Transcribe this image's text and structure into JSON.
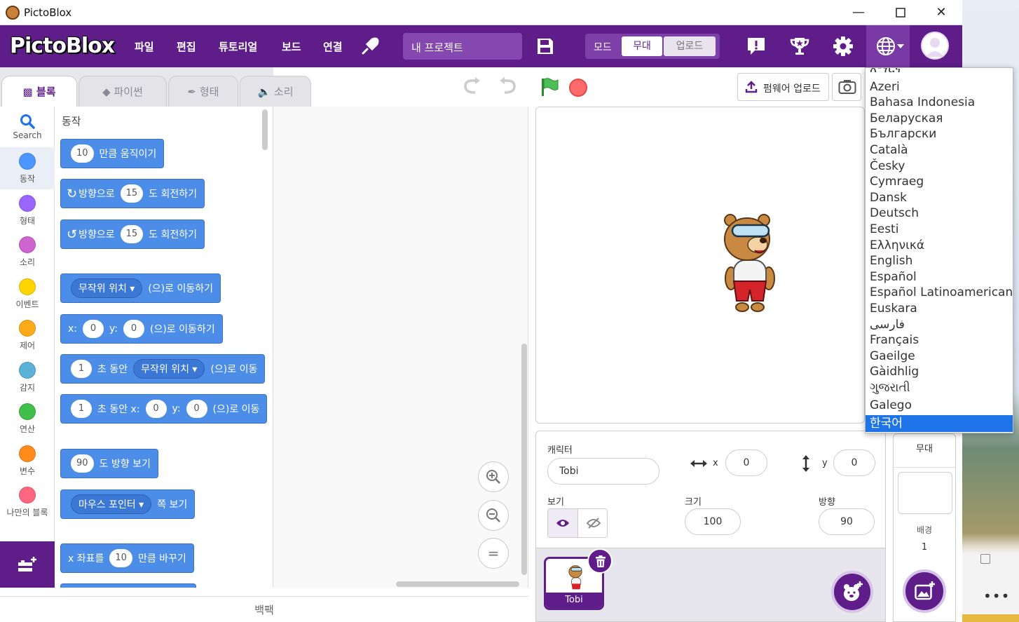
{
  "window": {
    "title": "PictoBlox"
  },
  "menubar": {
    "logo": "PictoBlox",
    "items": [
      "파일",
      "편집",
      "튜토리얼",
      "보드",
      "연결"
    ],
    "project_name": "내 프로젝트",
    "mode_label": "모드",
    "mode_stage": "무대",
    "mode_upload": "업로드"
  },
  "tabs": {
    "blocks": "블록",
    "python": "파이썬",
    "costumes": "형태",
    "sounds": "소리"
  },
  "categories": [
    {
      "label": "Search",
      "color": ""
    },
    {
      "label": "동작",
      "color": "#4c97ff"
    },
    {
      "label": "형태",
      "color": "#9966ff"
    },
    {
      "label": "소리",
      "color": "#cf63cf"
    },
    {
      "label": "이벤트",
      "color": "#ffd500"
    },
    {
      "label": "제어",
      "color": "#ffab19"
    },
    {
      "label": "감지",
      "color": "#5cb1d6"
    },
    {
      "label": "연산",
      "color": "#40bf4a"
    },
    {
      "label": "변수",
      "color": "#ff8c1a"
    },
    {
      "label": "나만의 블록",
      "color": "#ff6680"
    }
  ],
  "palette": {
    "title": "동작",
    "blocks": {
      "move_n": "10",
      "move_t": "만큼 움직이기",
      "turnr_a": "방향으로",
      "turnr_n": "15",
      "turnr_b": "도 회전하기",
      "turnl_a": "방향으로",
      "turnl_n": "15",
      "turnl_b": "도 회전하기",
      "goto_dd": "무작위 위치",
      "goto_t": "(으)로 이동하기",
      "gxy_x": "x:",
      "gxy_xv": "0",
      "gxy_y": "y:",
      "gxy_yv": "0",
      "gxy_t": "(으)로 이동하기",
      "glide_n": "1",
      "glide_a": "초 동안",
      "glide_dd": "무작위 위치",
      "glide_t": "(으)로 이동",
      "gxy2_n": "1",
      "gxy2_a": "초 동안 x:",
      "gxy2_xv": "0",
      "gxy2_y": "y:",
      "gxy2_yv": "0",
      "gxy2_t": "(으)로 이동",
      "point_n": "90",
      "point_t": "도 방향 보기",
      "towards_dd": "마우스 포인터",
      "towards_t": "쪽 보기",
      "chx_a": "x 좌표를",
      "chx_n": "10",
      "chx_t": "만큼 바꾸기"
    }
  },
  "workspace": {
    "backpack": "백팩"
  },
  "stage_controls": {
    "firmware": "펌웨어 업로드"
  },
  "sprite_info": {
    "sprite_label": "캐릭터",
    "sprite_name": "Tobi",
    "x_label": "x",
    "x_value": "0",
    "y_label": "y",
    "y_value": "0",
    "show_label": "보기",
    "size_label": "크기",
    "size_value": "100",
    "direction_label": "방향",
    "direction_value": "90"
  },
  "sprites": [
    {
      "name": "Tobi"
    }
  ],
  "stage_panel": {
    "title": "무대",
    "backdrops_label": "배경",
    "backdrops_count": "1"
  },
  "language_menu": {
    "items": [
      "አማርኛ",
      "Azeri",
      "Bahasa Indonesia",
      "Беларуская",
      "Български",
      "Català",
      "Česky",
      "Cymraeg",
      "Dansk",
      "Deutsch",
      "Eesti",
      "Ελληνικά",
      "English",
      "Español",
      "Español Latinoamericano",
      "Euskara",
      "فارسی",
      "Français",
      "Gaeilge",
      "Gàidhlig",
      "ગુજરાતી",
      "Galego",
      "한국어"
    ],
    "selected": "한국어"
  },
  "colors": {
    "brand": "#5e1d89",
    "motion": "#4c97ff",
    "selection": "#1e73e8"
  }
}
